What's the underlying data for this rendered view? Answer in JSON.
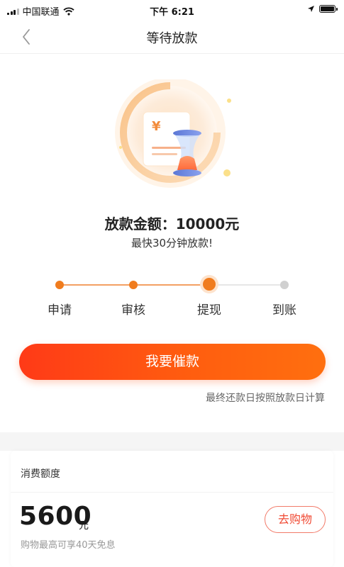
{
  "status_bar": {
    "carrier": "中国联通",
    "time": "下午 6:21"
  },
  "nav": {
    "title": "等待放款"
  },
  "hero": {
    "currency_symbol": "¥"
  },
  "loan": {
    "amount_text": "放款金额：10000元",
    "speed_text": "最快30分钟放款!"
  },
  "steps": {
    "items": [
      {
        "label": "申请",
        "state": "done"
      },
      {
        "label": "审核",
        "state": "done"
      },
      {
        "label": "提现",
        "state": "current"
      },
      {
        "label": "到账",
        "state": "pending"
      }
    ],
    "active_color": "#f07c1e",
    "pending_color": "#d0d0d0"
  },
  "actions": {
    "urge_label": "我要催款",
    "note": "最终还款日按照放款日计算"
  },
  "credit_card": {
    "title": "消费额度",
    "value": "5600",
    "unit": "元",
    "subtitle": "购物最高可享40天免息",
    "shop_label": "去购物"
  },
  "colors": {
    "accent": "#ff4a14",
    "shop_text": "#f04a34"
  }
}
